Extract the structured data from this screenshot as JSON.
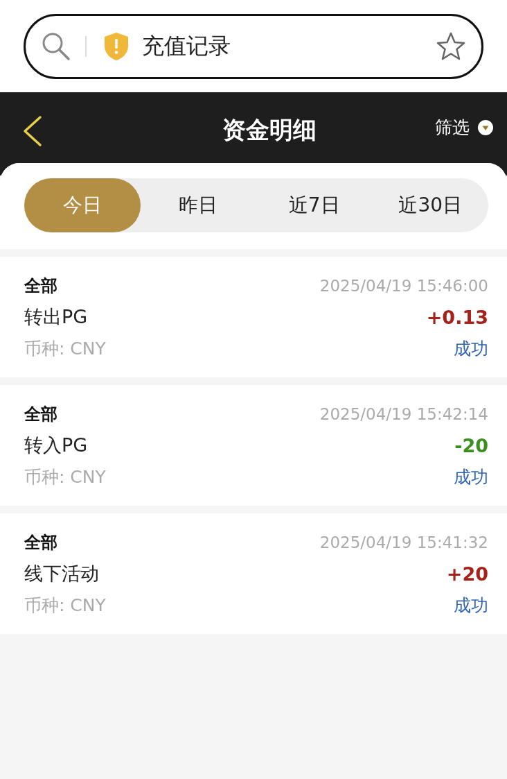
{
  "address_bar": {
    "title": "充值记录"
  },
  "header": {
    "title": "资金明细",
    "filter": "筛选"
  },
  "tabs": [
    {
      "label": "今日",
      "selected": true
    },
    {
      "label": "昨日",
      "selected": false
    },
    {
      "label": "近7日",
      "selected": false
    },
    {
      "label": "近30日",
      "selected": false
    }
  ],
  "records": [
    {
      "category": "全部",
      "time": "2025/04/19 15:46:00",
      "name": "转出PG",
      "amount": "+0.13",
      "color": "#a8201a",
      "currency": "币种: CNY",
      "status": "成功"
    },
    {
      "category": "全部",
      "time": "2025/04/19 15:42:14",
      "name": "转入PG",
      "amount": "-20",
      "color": "#3a8f1e",
      "currency": "币种: CNY",
      "status": "成功"
    },
    {
      "category": "全部",
      "time": "2025/04/19 15:41:32",
      "name": "线下活动",
      "amount": "+20",
      "color": "#a8201a",
      "currency": "币种: CNY",
      "status": "成功"
    }
  ]
}
